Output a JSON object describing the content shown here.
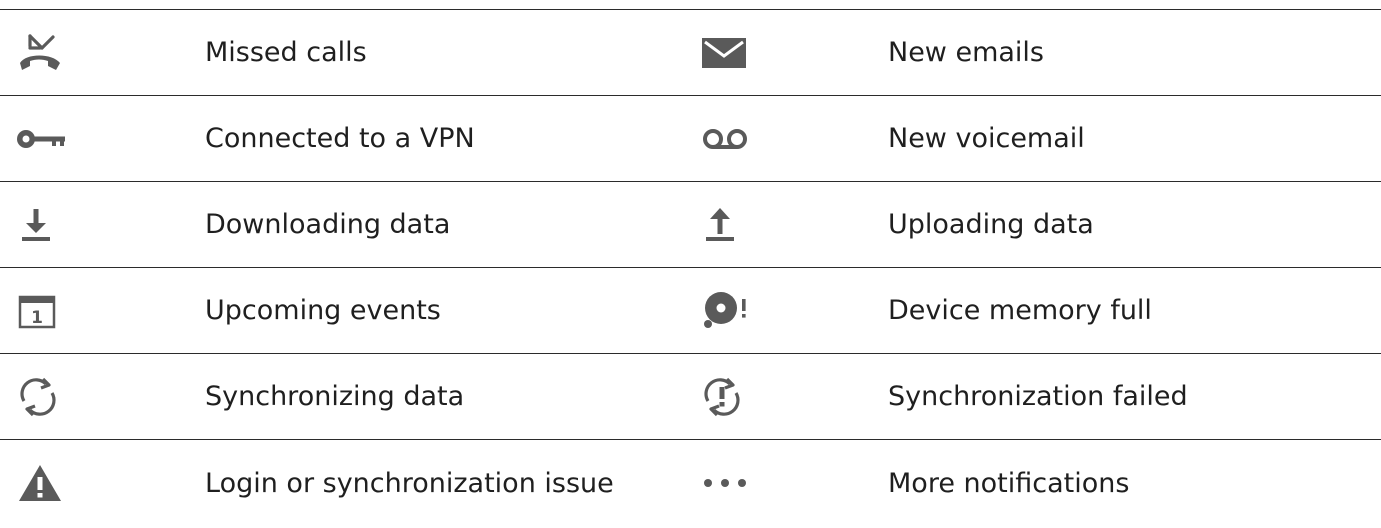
{
  "icon_color": "#5a5a5a",
  "rule_color": "#2b2b2b",
  "rows": [
    {
      "left": {
        "icon": "missed-call-icon",
        "label": "Missed calls"
      },
      "right": {
        "icon": "email-icon",
        "label": "New emails"
      }
    },
    {
      "left": {
        "icon": "vpn-key-icon",
        "label": "Connected to a VPN"
      },
      "right": {
        "icon": "voicemail-icon",
        "label": "New voicemail"
      }
    },
    {
      "left": {
        "icon": "download-icon",
        "label": "Downloading data"
      },
      "right": {
        "icon": "upload-icon",
        "label": "Uploading data"
      }
    },
    {
      "left": {
        "icon": "calendar-icon",
        "label": "Upcoming events",
        "icon_text": "1"
      },
      "right": {
        "icon": "memory-full-icon",
        "label": "Device memory full"
      }
    },
    {
      "left": {
        "icon": "sync-icon",
        "label": "Synchronizing data"
      },
      "right": {
        "icon": "sync-failed-icon",
        "label": "Synchronization failed"
      }
    },
    {
      "left": {
        "icon": "warning-icon",
        "label": "Login or synchronization issue"
      },
      "right": {
        "icon": "more-notifications-icon",
        "label": "More notifications"
      }
    }
  ]
}
